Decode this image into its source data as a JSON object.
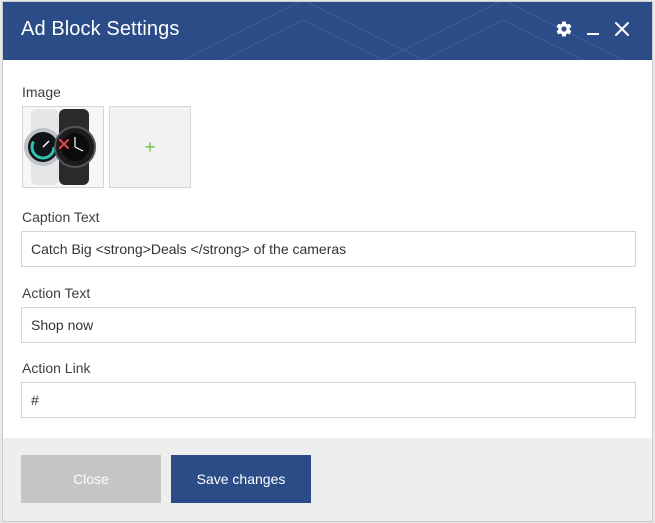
{
  "dialog": {
    "title": "Ad Block Settings"
  },
  "titlebar_icons": {
    "settings": "gear-icon",
    "minimize": "minimize-icon",
    "close": "close-icon"
  },
  "image_section": {
    "label": "Image",
    "add_symbol": "+"
  },
  "caption": {
    "label": "Caption Text",
    "value": "Catch Big <strong>Deals </strong> of the cameras"
  },
  "action_text": {
    "label": "Action Text",
    "value": "Shop now"
  },
  "action_link": {
    "label": "Action Link",
    "value": "#"
  },
  "footer": {
    "close_label": "Close",
    "save_label": "Save changes"
  },
  "colors": {
    "header": "#2c4c88",
    "primary_button": "#2c4c88",
    "disabled_button": "#c5c5c5",
    "add_plus": "#6cbf3c",
    "remove_x": "#e0414f"
  }
}
